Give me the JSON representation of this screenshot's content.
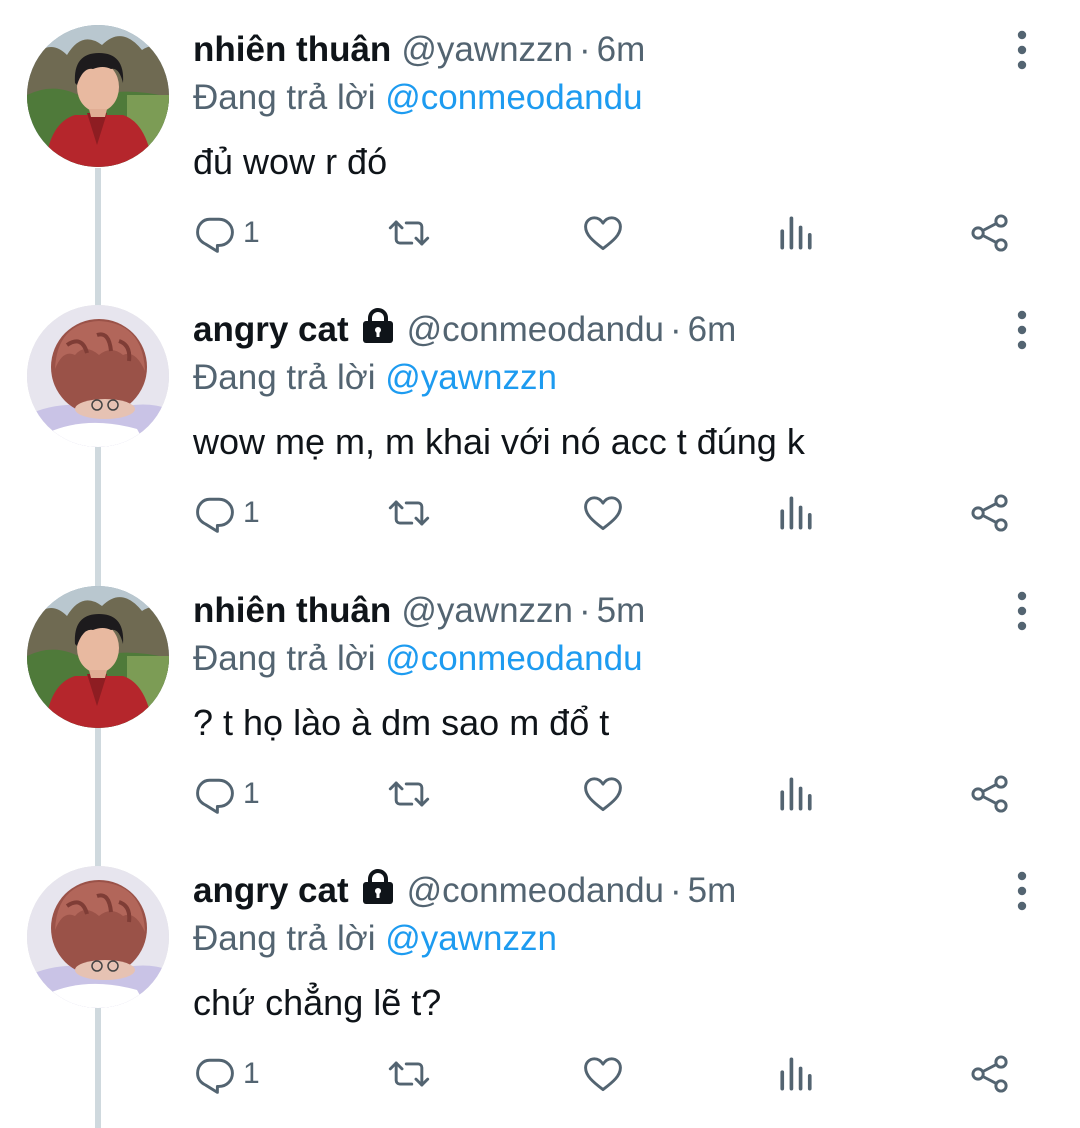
{
  "colors": {
    "text": "#0f1419",
    "secondary": "#536471",
    "link": "#1d9bf0",
    "thread_line": "#cfd9de"
  },
  "reply_prefix": "Đang trả lời",
  "tweets": [
    {
      "display_name": "nhiên thuân",
      "protected": false,
      "handle": "@yawnzzn",
      "separator": "·",
      "time": "6m",
      "reply_to": "@conmeodandu",
      "text": "đủ wow r đó",
      "reply_count": "1",
      "avatar": "avatar-photo-boy-red-shirt"
    },
    {
      "display_name": "angry cat",
      "protected": true,
      "handle": "@conmeodandu",
      "separator": "·",
      "time": "6m",
      "reply_to": "@yawnzzn",
      "text": "wow mẹ m, m khai với nó acc t đúng k",
      "reply_count": "1",
      "avatar": "avatar-photo-red-hair"
    },
    {
      "display_name": "nhiên thuân",
      "protected": false,
      "handle": "@yawnzzn",
      "separator": "·",
      "time": "5m",
      "reply_to": "@conmeodandu",
      "text": "? t họ lào à dm sao m đổ t",
      "reply_count": "1",
      "avatar": "avatar-photo-boy-red-shirt"
    },
    {
      "display_name": "angry cat",
      "protected": true,
      "handle": "@conmeodandu",
      "separator": "·",
      "time": "5m",
      "reply_to": "@yawnzzn",
      "text": "chứ chẳng lẽ t?",
      "reply_count": "1",
      "avatar": "avatar-photo-red-hair"
    }
  ]
}
